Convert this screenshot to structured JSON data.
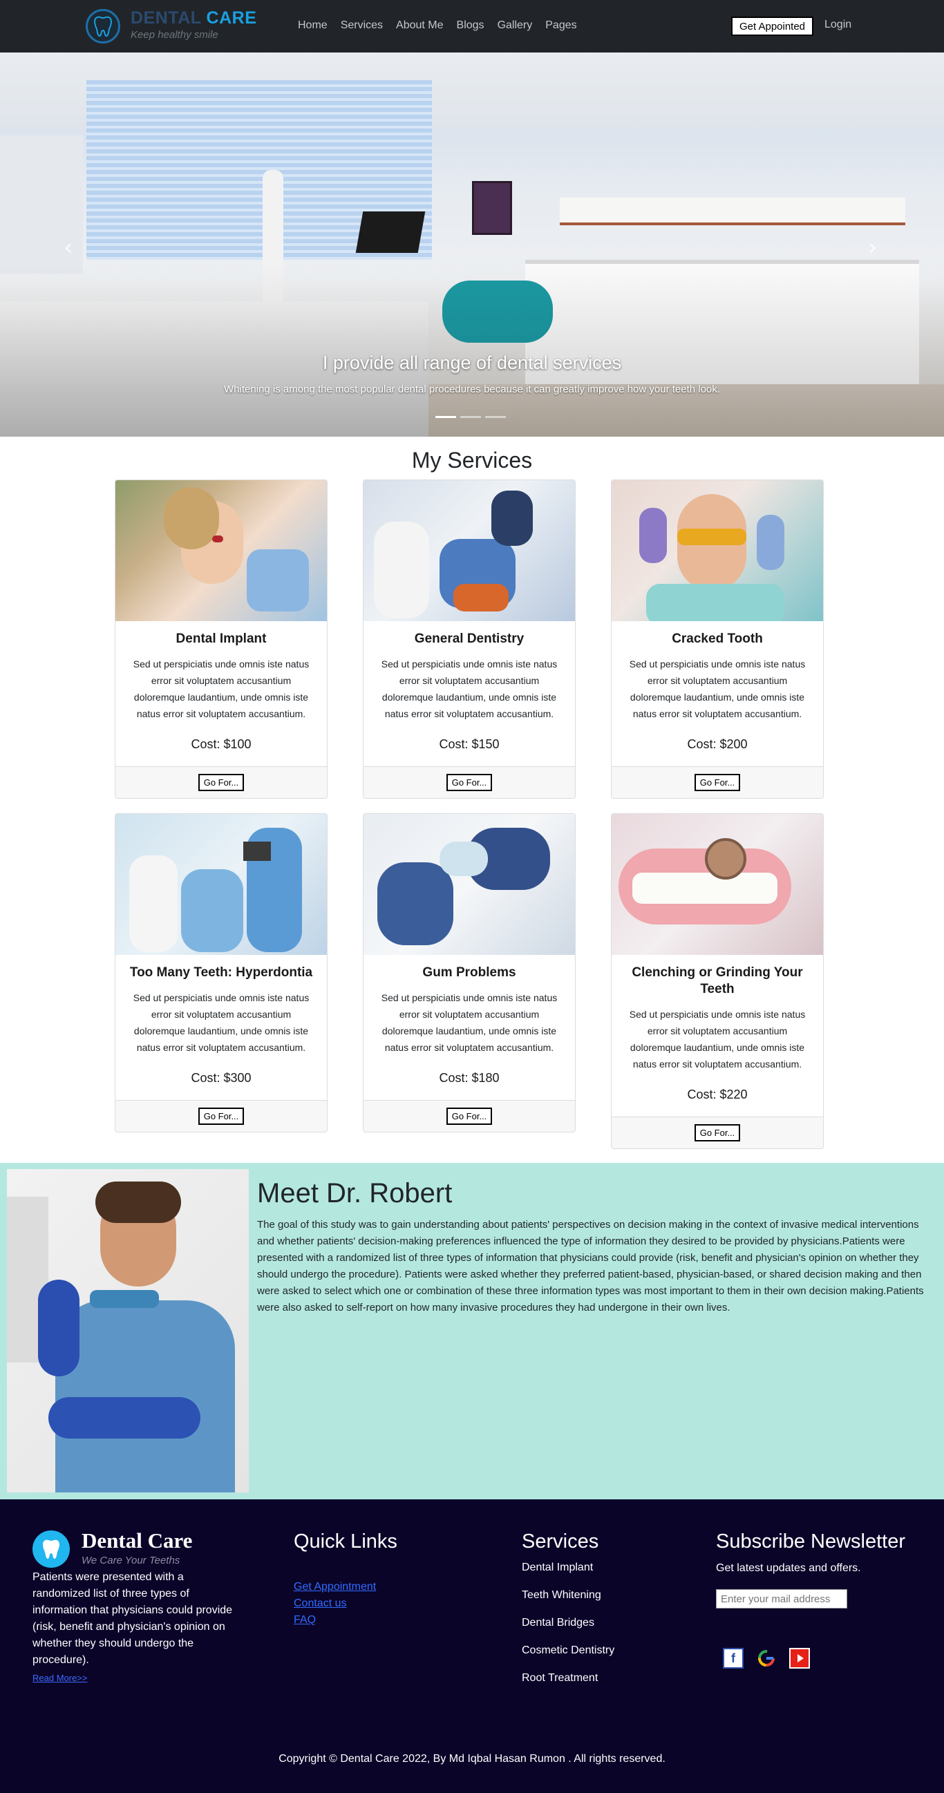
{
  "brand": {
    "name_part1": "DENTAL",
    "name_part2": "CARE",
    "tagline": "Keep healthy smile"
  },
  "nav": {
    "links": [
      "Home",
      "Services",
      "About Me",
      "Blogs",
      "Gallery",
      "Pages"
    ],
    "appoint_label": "Get Appointed",
    "login_label": "Login"
  },
  "hero": {
    "title": "I provide all range of dental services",
    "subtitle": "Whitening is among the most popular dental procedures because it can greatly improve how your teeth look.",
    "prev_icon": "chevron-left-icon",
    "next_icon": "chevron-right-icon"
  },
  "services": {
    "title": "My Services",
    "items": [
      {
        "name": "Dental Implant",
        "desc": "Sed ut perspiciatis unde omnis iste natus error sit voluptatem accusantium doloremque laudantium, unde omnis iste natus error sit voluptatem accusantium.",
        "cost": "Cost: $100",
        "button": "Go For..."
      },
      {
        "name": "General Dentistry",
        "desc": "Sed ut perspiciatis unde omnis iste natus error sit voluptatem accusantium doloremque laudantium, unde omnis iste natus error sit voluptatem accusantium.",
        "cost": "Cost: $150",
        "button": "Go For..."
      },
      {
        "name": "Cracked Tooth",
        "desc": "Sed ut perspiciatis unde omnis iste natus error sit voluptatem accusantium doloremque laudantium, unde omnis iste natus error sit voluptatem accusantium.",
        "cost": "Cost: $200",
        "button": "Go For..."
      },
      {
        "name": "Too Many Teeth: Hyperdontia",
        "desc": "Sed ut perspiciatis unde omnis iste natus error sit voluptatem accusantium doloremque laudantium, unde omnis iste natus error sit voluptatem accusantium.",
        "cost": "Cost: $300",
        "button": "Go For..."
      },
      {
        "name": "Gum Problems",
        "desc": "Sed ut perspiciatis unde omnis iste natus error sit voluptatem accusantium doloremque laudantium, unde omnis iste natus error sit voluptatem accusantium.",
        "cost": "Cost: $180",
        "button": "Go For..."
      },
      {
        "name": "Clenching or Grinding Your Teeth",
        "desc": "Sed ut perspiciatis unde omnis iste natus error sit voluptatem accusantium doloremque laudantium, unde omnis iste natus error sit voluptatem accusantium.",
        "cost": "Cost: $220",
        "button": "Go For..."
      }
    ]
  },
  "doctor": {
    "title": "Meet Dr. Robert",
    "text": "The goal of this study was to gain understanding about patients' perspectives on decision making in the context of invasive medical interventions and whether patients' decision-making preferences influenced the type of information they desired to be provided by physicians.Patients were presented with a randomized list of three types of information that physicians could provide (risk, benefit and physician's opinion on whether they should undergo the procedure). Patients were asked whether they preferred patient-based, physician-based, or shared decision making and then were asked to select which one or combination of these three information types was most important to them in their own decision making.Patients were also asked to self-report on how many invasive procedures they had undergone in their own lives."
  },
  "footer": {
    "brand": "Dental Care",
    "tagline": "We Care Your Teeths",
    "about": "Patients were presented with a randomized list of three types of information that physicians could provide (risk, benefit and physician's opinion on whether they should undergo the procedure).",
    "read_more": "Read More>>",
    "quick_links_title": "Quick Links",
    "quick_links": [
      "Get Appointment",
      "Contact us",
      "FAQ"
    ],
    "services_title": "Services",
    "services": [
      "Dental Implant",
      "Teeth Whitening",
      "Dental Bridges",
      "Cosmetic Dentistry",
      "Root Treatment"
    ],
    "newsletter_title": "Subscribe Newsletter",
    "newsletter_sub": "Get latest updates and offers.",
    "email_placeholder": "Enter your mail address",
    "social": [
      "facebook-icon",
      "google-icon",
      "youtube-icon"
    ],
    "copyright": "Copyright © Dental Care 2022, By Md Iqbal Hasan Rumon . All rights reserved."
  },
  "colors": {
    "nav_bg": "#212529",
    "accent": "#1aa0e0",
    "doctor_bg": "#b4e8df",
    "footer_bg": "#0b0429"
  }
}
